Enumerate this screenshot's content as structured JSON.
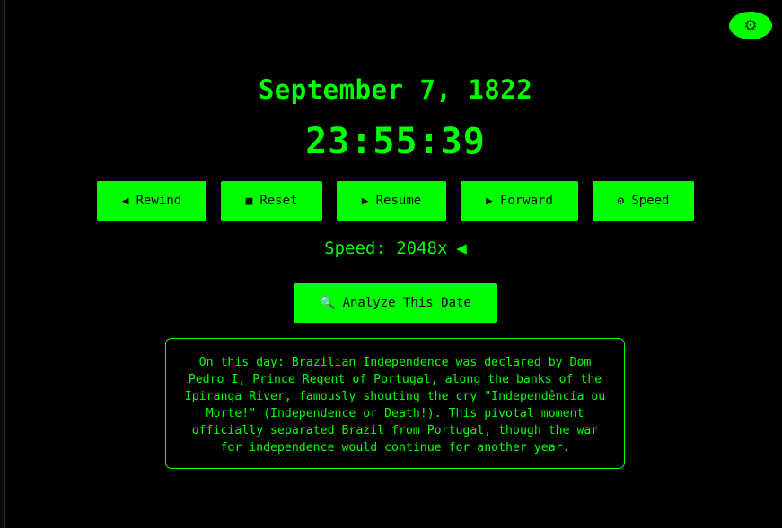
{
  "settings": {
    "icon": "gear-icon",
    "glyph": "⚙"
  },
  "clock": {
    "date": "September 7, 1822",
    "time": "23:55:39"
  },
  "controls": [
    {
      "glyph": "◀",
      "icon": "rewind-icon",
      "label": "Rewind"
    },
    {
      "glyph": "■",
      "icon": "stop-icon",
      "label": "Reset"
    },
    {
      "glyph": "▶",
      "icon": "play-icon",
      "label": "Resume"
    },
    {
      "glyph": "▶",
      "icon": "forward-icon",
      "label": "Forward"
    },
    {
      "glyph": "⚙",
      "icon": "gear-icon",
      "label": "Speed"
    }
  ],
  "speed": {
    "text": "Speed: 2048x",
    "direction_glyph": "◀"
  },
  "analyze": {
    "glyph": "🔍",
    "icon": "magnifier-icon",
    "label": "Analyze This Date"
  },
  "info": {
    "text": "On this day: Brazilian Independence was declared by Dom Pedro I, Prince Regent of Portugal, along the banks of the Ipiranga River, famously shouting the cry \"Independência ou Morte!\" (Independence or Death!). This pivotal moment officially separated Brazil from Portugal, though the war for independence would continue for another year."
  },
  "colors": {
    "accent": "#00ff00",
    "background": "#000000",
    "button_text": "#0a0a0a"
  }
}
